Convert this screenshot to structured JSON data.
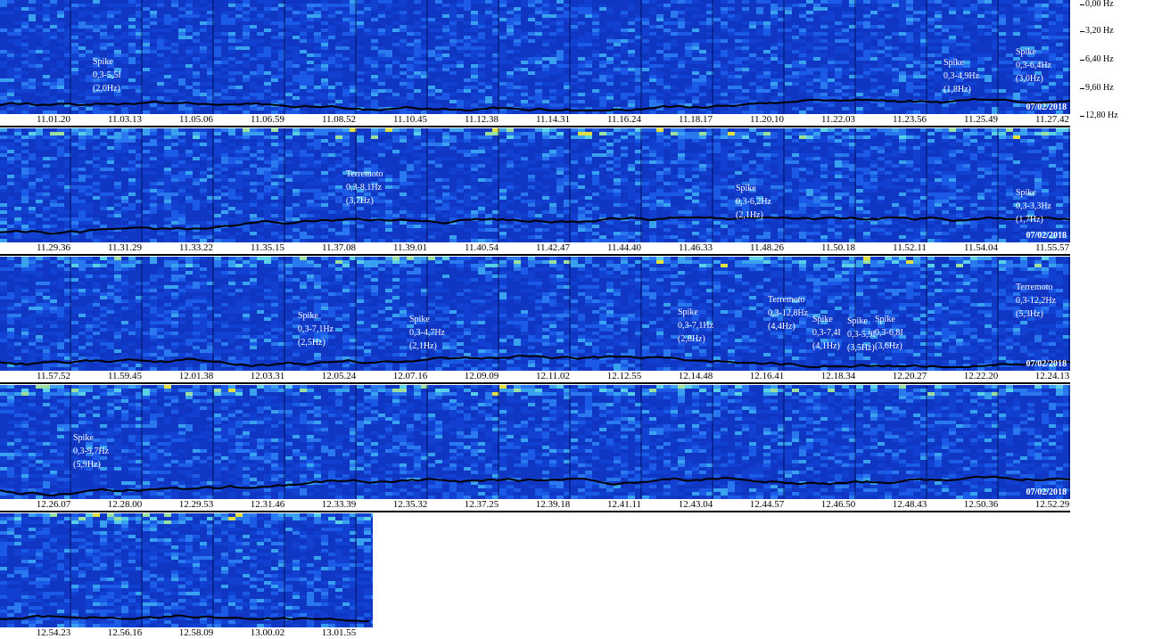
{
  "freq_axis": [
    "0,00 Hz",
    "3,20 Hz",
    "6,40 Hz",
    "9,60 Hz",
    "12,80 Hz"
  ],
  "date": "07/02/2018",
  "chart_data": [
    {
      "type": "heatmap",
      "times": [
        "11.01.20",
        "11.03.13",
        "11.05.06",
        "11.06.59",
        "11.08.52",
        "11.10.45",
        "11.12.38",
        "11.14.31",
        "11.16.24",
        "11.18.17",
        "11.20.10",
        "11.22.03",
        "11.23.56",
        "11.25.49",
        "11.27.42"
      ],
      "annotations": [
        {
          "title": "Spike",
          "range": "0,3-5,5I",
          "peak": "(2,0Hz)"
        },
        {
          "title": "Spike",
          "range": "0,3-4,9Hz",
          "peak": "(1,8Hz)"
        },
        {
          "title": "Spike",
          "range": "0,3-6,4Hz",
          "peak": "(3,0Hz)"
        }
      ]
    },
    {
      "type": "heatmap",
      "times": [
        "11.29.36",
        "11.31.29",
        "11.33.22",
        "11.35.15",
        "11.37.08",
        "11.39.01",
        "11.40.54",
        "11.42.47",
        "11.44.40",
        "11.46.33",
        "11.48.26",
        "11.50.18",
        "11.52.11",
        "11.54.04",
        "11.55.57"
      ],
      "annotations": [
        {
          "title": "Terremoto",
          "range": "0,3-8,1Hz",
          "peak": "(3,7Hz)"
        },
        {
          "title": "Spike",
          "range": "0,3-6,2Hz",
          "peak": "(2,1Hz)"
        },
        {
          "title": "Spike",
          "range": "0,3-3,3Hz",
          "peak": "(1,7Hz)"
        }
      ]
    },
    {
      "type": "heatmap",
      "times": [
        "11.57.52",
        "11.59.45",
        "12.01.38",
        "12.03.31",
        "12.05.24",
        "12.07.16",
        "12.09.09",
        "12.11.02",
        "12.12.55",
        "12.14.48",
        "12.16.41",
        "12.18.34",
        "12.20.27",
        "12.22.20",
        "12.24.13"
      ],
      "annotations": [
        {
          "title": "Spike",
          "range": "0,3-7,1Hz",
          "peak": "(2,5Hz)"
        },
        {
          "title": "Spike",
          "range": "0,3-4,7Hz",
          "peak": "(2,1Hz)"
        },
        {
          "title": "Spike",
          "range": "0,3-7,1Hz",
          "peak": "(2,8Hz)"
        },
        {
          "title": "Terremoto",
          "range": "0,3-12,8Hz",
          "peak": "(4,4Hz)"
        },
        {
          "title": "Spike",
          "range": "0,3-7,4I",
          "peak": "(4,1Hz)"
        },
        {
          "title": "Spike",
          "range": "0,3-5,9I",
          "peak": "(3,5Hz)"
        },
        {
          "title": "Spike",
          "range": "0,3-6,8I",
          "peak": "(3,6Hz)"
        },
        {
          "title": "Terremoto",
          "range": "0,3-12,2Hz",
          "peak": "(5,3Hz)"
        }
      ]
    },
    {
      "type": "heatmap",
      "times": [
        "12.26.07",
        "12.28.00",
        "12.29.53",
        "12.31.46",
        "12.33.39",
        "12.35.32",
        "12.37.25",
        "12.39.18",
        "12.41.11",
        "12.43.04",
        "12.44.57",
        "12.46.50",
        "12.48.43",
        "12.50.36",
        "12.52.29"
      ],
      "annotations": [
        {
          "title": "Spike",
          "range": "0,3-9,7Hz",
          "peak": "(5,9Hz)"
        }
      ]
    },
    {
      "type": "heatmap",
      "times": [
        "12.54.23",
        "12.56.16",
        "12.58.09",
        "13.00.02",
        "13.01.55"
      ],
      "annotations": []
    }
  ]
}
